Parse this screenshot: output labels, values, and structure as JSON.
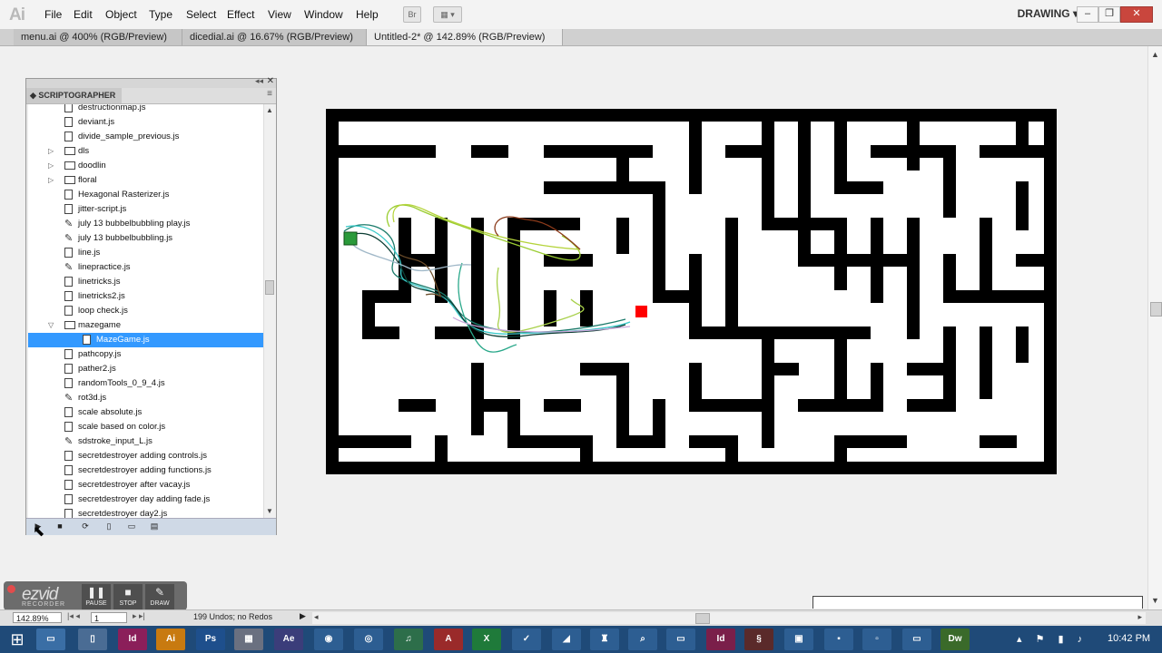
{
  "app": {
    "logo": "Ai",
    "menu": [
      "File",
      "Edit",
      "Object",
      "Type",
      "Select",
      "Effect",
      "View",
      "Window",
      "Help"
    ],
    "bridge_button": "Br",
    "workspace": "DRAWING"
  },
  "tabs": [
    {
      "label": "menu.ai @ 400% (RGB/Preview)",
      "active": false
    },
    {
      "label": "dicedial.ai @ 16.67% (RGB/Preview)",
      "active": false
    },
    {
      "label": "Untitled-2* @ 142.89% (RGB/Preview)",
      "active": true
    }
  ],
  "panel": {
    "title": "SCRIPTOGRAPHER",
    "items": [
      {
        "label": "destructionmap.js",
        "type": "file",
        "indent": 1
      },
      {
        "label": "deviant.js",
        "type": "file",
        "indent": 1
      },
      {
        "label": "divide_sample_previous.js",
        "type": "file",
        "indent": 1
      },
      {
        "label": "dls",
        "type": "folder",
        "indent": 1,
        "expanded": false
      },
      {
        "label": "doodlin",
        "type": "folder",
        "indent": 1,
        "expanded": false
      },
      {
        "label": "floral",
        "type": "folder",
        "indent": 1,
        "expanded": false
      },
      {
        "label": "Hexagonal Rasterizer.js",
        "type": "file",
        "indent": 1
      },
      {
        "label": "jitter-script.js",
        "type": "file",
        "indent": 1
      },
      {
        "label": "july 13 bubbelbubbling play.js",
        "type": "tool",
        "indent": 1
      },
      {
        "label": "july 13 bubbelbubbling.js",
        "type": "tool",
        "indent": 1
      },
      {
        "label": "line.js",
        "type": "file",
        "indent": 1
      },
      {
        "label": "linepractice.js",
        "type": "tool",
        "indent": 1
      },
      {
        "label": "linetricks.js",
        "type": "file",
        "indent": 1
      },
      {
        "label": "linetricks2.js",
        "type": "file",
        "indent": 1
      },
      {
        "label": "loop check.js",
        "type": "file",
        "indent": 1
      },
      {
        "label": "mazegame",
        "type": "folder",
        "indent": 1,
        "expanded": true
      },
      {
        "label": "MazeGame.js",
        "type": "file",
        "indent": 2,
        "selected": true
      },
      {
        "label": "pathcopy.js",
        "type": "file",
        "indent": 1
      },
      {
        "label": "pather2.js",
        "type": "file",
        "indent": 1
      },
      {
        "label": "randomTools_0_9_4.js",
        "type": "file",
        "indent": 1
      },
      {
        "label": "rot3d.js",
        "type": "tool",
        "indent": 1
      },
      {
        "label": "scale absolute.js",
        "type": "file",
        "indent": 1
      },
      {
        "label": "scale based on color.js",
        "type": "file",
        "indent": 1
      },
      {
        "label": "sdstroke_input_L.js",
        "type": "tool",
        "indent": 1
      },
      {
        "label": "secretdestroyer adding controls.js",
        "type": "file",
        "indent": 1
      },
      {
        "label": "secretdestroyer adding functions.js",
        "type": "file",
        "indent": 1
      },
      {
        "label": "secretdestroyer after vacay.js",
        "type": "file",
        "indent": 1
      },
      {
        "label": "secretdestroyer day adding fade.js",
        "type": "file",
        "indent": 1
      },
      {
        "label": "secretdestroyer day2.js",
        "type": "file",
        "indent": 1
      }
    ]
  },
  "ezvid": {
    "logo": "ezvid",
    "sub": "RECORDER",
    "pause": "PAUSE",
    "stop": "STOP",
    "draw": "DRAW"
  },
  "status": {
    "zoom": "142.89%",
    "artboard": "1",
    "undo": "199 Undos; no Redos"
  },
  "taskbar": {
    "time": "10:42 PM"
  },
  "colors": {
    "selection": "#3399ff",
    "maze_wall": "#000000",
    "player_square": "#ff0000",
    "taskbar": "#1f4a78"
  }
}
